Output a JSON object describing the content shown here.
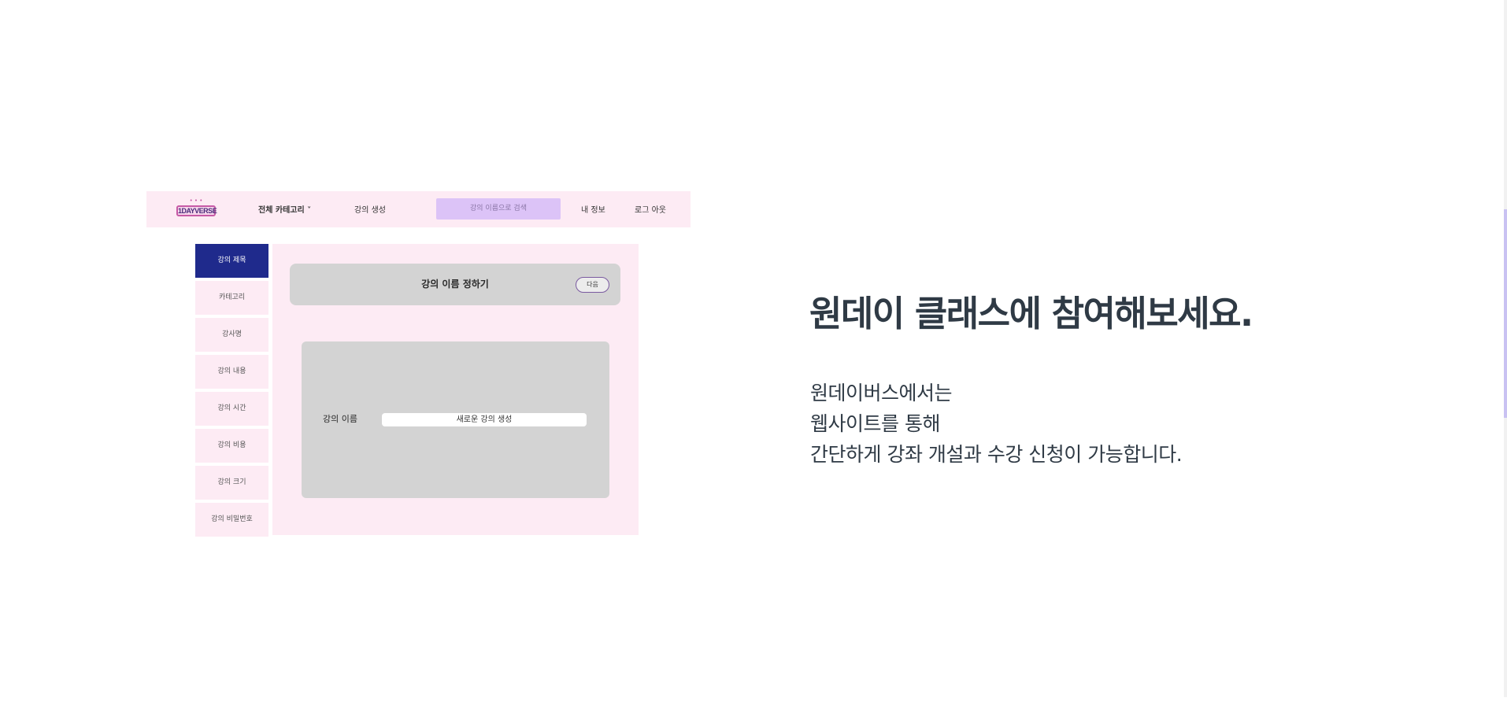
{
  "preview": {
    "logo_text": "1DAYVERSE",
    "logo_dots": "• • •",
    "nav": {
      "all_categories": "전체 카테고리 ˅",
      "create_class": "강의 생성",
      "search_placeholder": "강의 이름으로 검색",
      "my_info": "내 정보",
      "logout": "로그 아웃"
    },
    "sidebar_items": [
      {
        "label": "강의 제목"
      },
      {
        "label": "카테고리"
      },
      {
        "label": "강사명"
      },
      {
        "label": "강의 내용"
      },
      {
        "label": "강의 시간"
      },
      {
        "label": "강의 비용"
      },
      {
        "label": "강의 크기"
      },
      {
        "label": "강의 비밀번호"
      }
    ],
    "header_title": "강의 이름 정하기",
    "next_button": "다음",
    "form_label": "강의 이름",
    "form_value": "새로운 강의 생성"
  },
  "promo": {
    "headline": "원데이 클래스에 참여해보세요.",
    "lines": [
      "원데이버스에서는",
      "웹사이트를 통해",
      "간단하게 강좌 개설과 수강 신청이 가능합니다."
    ]
  },
  "colors": {
    "pink_bg": "#fdebf4",
    "active_navy": "#1f2a8c",
    "search_purple": "#dcc3f7",
    "card_gray": "#d3d3d3",
    "text_dark": "#2f3a45",
    "scroll_thumb": "#c9c2f2"
  }
}
